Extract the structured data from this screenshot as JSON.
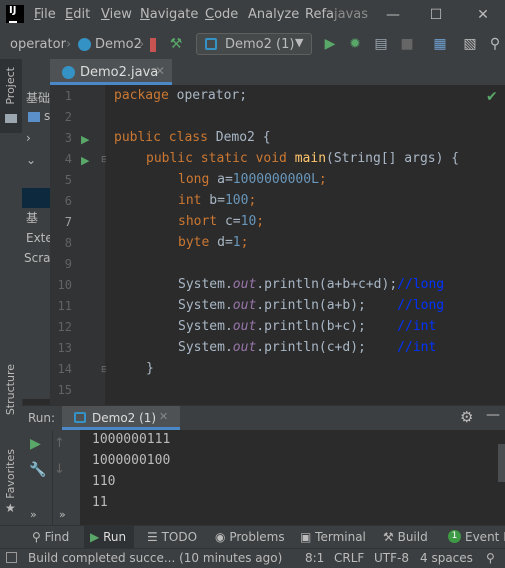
{
  "menu": {
    "items": [
      "File",
      "Edit",
      "View",
      "Navigate",
      "Code",
      "Analyze",
      "Refa"
    ],
    "underline": [
      "F",
      "E",
      "V",
      "N",
      "C",
      "",
      ""
    ],
    "project_name": "javas"
  },
  "toolbar": {
    "crumb_package": "operator",
    "crumb_class": "Demo2",
    "run_config": "Demo2 (1)"
  },
  "sidebar": {
    "project_label": "Project",
    "structure_label": "Structure",
    "favorites_label": "Favorites",
    "project_items": [
      "基础",
      "s",
      "",
      "",
      "基",
      "Exte",
      "Scra"
    ]
  },
  "editor": {
    "tab_label": "Demo2.java",
    "line_numbers": [
      "1",
      "2",
      "3",
      "4",
      "5",
      "6",
      "7",
      "8",
      "9",
      "10",
      "11",
      "12",
      "13",
      "14",
      "15"
    ]
  },
  "code": {
    "l1_kw": "package",
    "l1_rest": " operator;",
    "l3_kw": "public class",
    "l3_rest": " Demo2 {",
    "l4_kw": "public static void",
    "l4_fn": "main",
    "l4_rest": "(String[] args) {",
    "l5_kw": "long",
    "l5_a": " a=",
    "l5_num": "1000000000L",
    "l5_end": ";",
    "l6_kw": "int",
    "l6_a": " b=",
    "l6_num": "100",
    "l6_end": ";",
    "l7_kw": "short",
    "l7_a": " c=",
    "l7_num": "10",
    "l7_end": ";",
    "l8_kw": "byte",
    "l8_a": " d=",
    "l8_num": "1",
    "l8_end": ";",
    "l10_a": "System.",
    "l10_out": "out",
    "l10_b": ".println(a+b+c+d);",
    "l10_cmt": "//long",
    "l11_a": "System.",
    "l11_out": "out",
    "l11_b": ".println(a+b);    ",
    "l11_cmt": "//long",
    "l12_a": "System.",
    "l12_out": "out",
    "l12_b": ".println(b+c);    ",
    "l12_cmt": "//int",
    "l13_a": "System.",
    "l13_out": "out",
    "l13_b": ".println(c+d);    ",
    "l13_cmt": "//int",
    "l14": "}"
  },
  "run": {
    "label": "Run:",
    "tab_label": "Demo2 (1)",
    "output": [
      "1000000111",
      "1000000100",
      "110",
      "11"
    ]
  },
  "bottom_tabs": {
    "find": "Find",
    "run": "Run",
    "todo": "TODO",
    "problems": "Problems",
    "terminal": "Terminal",
    "build": "Build",
    "event_log": "Event Lo"
  },
  "status": {
    "message": "Build completed succe... (10 minutes ago)",
    "position": "8:1",
    "line_sep": "CRLF",
    "encoding": "UTF-8",
    "indent": "4 spaces"
  },
  "colors": {
    "keyword": "#cc7832",
    "function": "#ffc66d",
    "number": "#6897bb",
    "static_field": "#9876aa",
    "comment": "#0033ff",
    "run_green": "#59a869"
  }
}
